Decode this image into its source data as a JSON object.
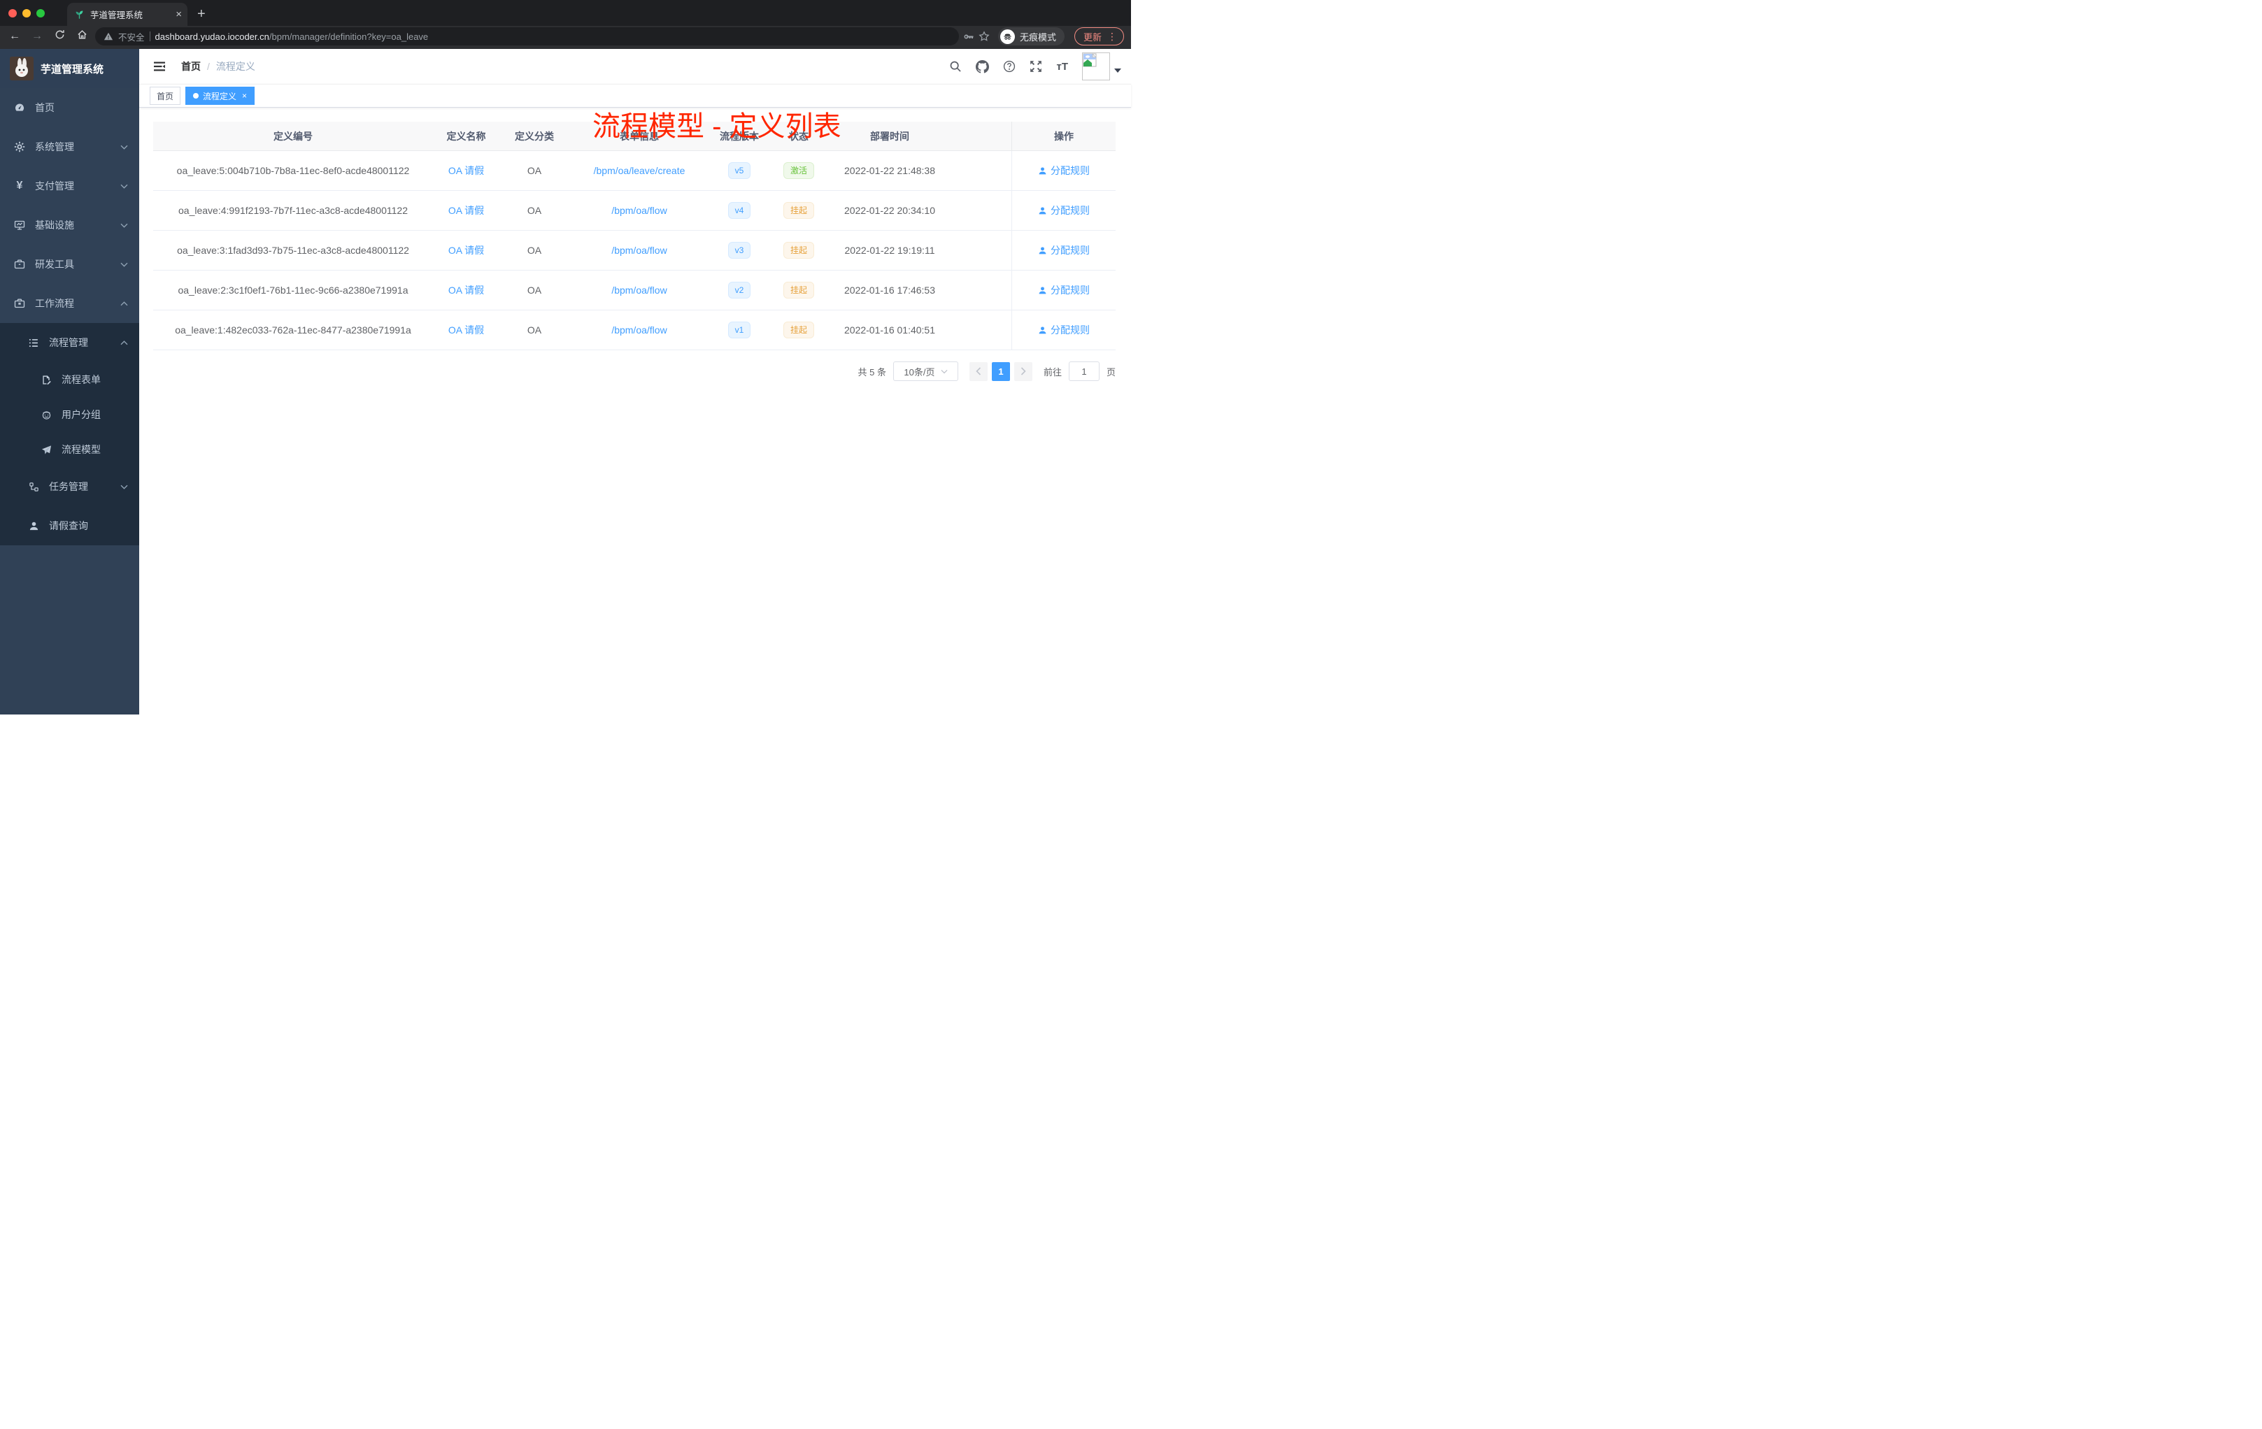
{
  "browser": {
    "tab": {
      "title": "芋道管理系统",
      "close": "×",
      "new_tab": "+"
    },
    "address": {
      "security": "不安全",
      "host": "dashboard.yudao.iocoder.cn",
      "path": "/bpm/manager/definition?key=oa_leave"
    },
    "incognito_label": "无痕模式",
    "update_label": "更新",
    "menu_dots": "⋮"
  },
  "sidebar": {
    "app_title": "芋道管理系统",
    "items": [
      {
        "label": "首页"
      },
      {
        "label": "系统管理"
      },
      {
        "label": "支付管理"
      },
      {
        "label": "基础设施"
      },
      {
        "label": "研发工具"
      },
      {
        "label": "工作流程"
      },
      {
        "label": "流程管理"
      },
      {
        "label": "流程表单"
      },
      {
        "label": "用户分组"
      },
      {
        "label": "流程模型"
      },
      {
        "label": "任务管理"
      },
      {
        "label": "请假查询"
      }
    ]
  },
  "header": {
    "breadcrumb_home": "首页",
    "breadcrumb_sep": "/",
    "breadcrumb_current": "流程定义",
    "annotation": "流程模型 - 定义列表"
  },
  "tags": {
    "home": "首页",
    "active": "流程定义",
    "close": "×"
  },
  "table": {
    "columns": [
      "定义编号",
      "定义名称",
      "定义分类",
      "表单信息",
      "流程版本",
      "状态",
      "部署时间",
      "操作"
    ],
    "rows": [
      {
        "id": "oa_leave:5:004b710b-7b8a-11ec-8ef0-acde48001122",
        "name": "OA 请假",
        "category": "OA",
        "form": "/bpm/oa/leave/create",
        "version": "v5",
        "status": "激活",
        "deployed_at": "2022-01-22 21:48:38",
        "action": "分配规则"
      },
      {
        "id": "oa_leave:4:991f2193-7b7f-11ec-a3c8-acde48001122",
        "name": "OA 请假",
        "category": "OA",
        "form": "/bpm/oa/flow",
        "version": "v4",
        "status": "挂起",
        "deployed_at": "2022-01-22 20:34:10",
        "action": "分配规则"
      },
      {
        "id": "oa_leave:3:1fad3d93-7b75-11ec-a3c8-acde48001122",
        "name": "OA 请假",
        "category": "OA",
        "form": "/bpm/oa/flow",
        "version": "v3",
        "status": "挂起",
        "deployed_at": "2022-01-22 19:19:11",
        "action": "分配规则"
      },
      {
        "id": "oa_leave:2:3c1f0ef1-76b1-11ec-9c66-a2380e71991a",
        "name": "OA 请假",
        "category": "OA",
        "form": "/bpm/oa/flow",
        "version": "v2",
        "status": "挂起",
        "deployed_at": "2022-01-16 17:46:53",
        "action": "分配规则"
      },
      {
        "id": "oa_leave:1:482ec033-762a-11ec-8477-a2380e71991a",
        "name": "OA 请假",
        "category": "OA",
        "form": "/bpm/oa/flow",
        "version": "v1",
        "status": "挂起",
        "deployed_at": "2022-01-16 01:40:51",
        "action": "分配规则"
      }
    ]
  },
  "pagination": {
    "total": "共 5 条",
    "page_size": "10条/页",
    "page": "1",
    "goto": "前往",
    "goto_value": "1",
    "unit": "页"
  },
  "colors": {
    "accent": "#409eff",
    "annotation_red": "#ff2600",
    "status_active": "#67c23a",
    "status_suspended": "#e6a23c",
    "sidebar_bg": "#304156",
    "sidebar_submenu_bg": "#1f2d3d"
  }
}
